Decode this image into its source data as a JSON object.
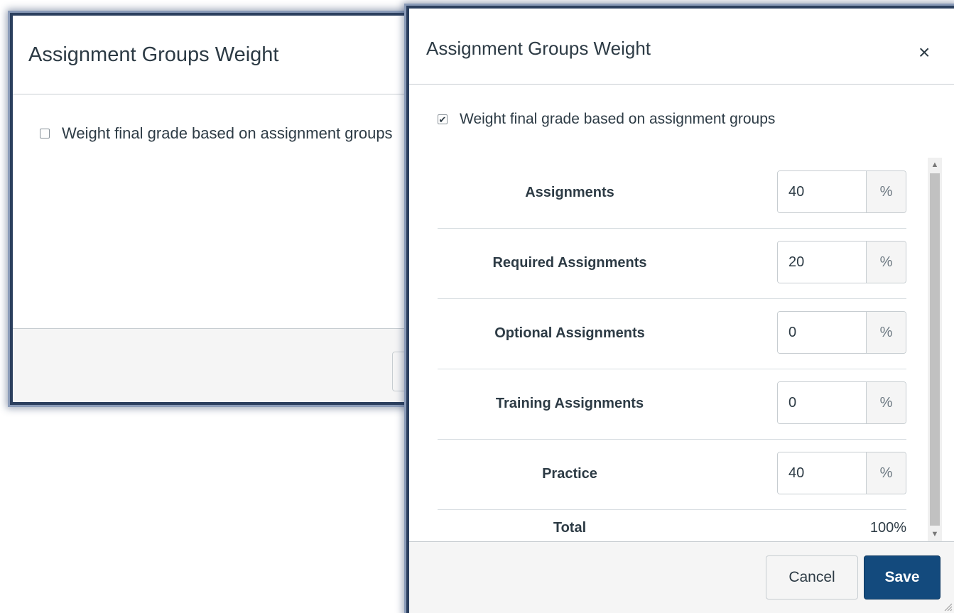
{
  "back_dialog": {
    "title": "Assignment Groups Weight",
    "checkbox_label": "Weight final grade based on assignment groups",
    "checked": false
  },
  "front_dialog": {
    "title": "Assignment Groups Weight",
    "close_glyph": "×",
    "checkbox_label": "Weight final grade based on assignment groups",
    "checked": true,
    "check_glyph": "✔",
    "groups": [
      {
        "name": "Assignments",
        "weight": "40",
        "unit": "%"
      },
      {
        "name": "Required Assignments",
        "weight": "20",
        "unit": "%"
      },
      {
        "name": "Optional Assignments",
        "weight": "0",
        "unit": "%"
      },
      {
        "name": "Training Assignments",
        "weight": "0",
        "unit": "%"
      },
      {
        "name": "Practice",
        "weight": "40",
        "unit": "%"
      }
    ],
    "total_label": "Total",
    "total_value": "100%",
    "scroll_up_glyph": "▲",
    "scroll_down_glyph": "▼",
    "buttons": {
      "cancel": "Cancel",
      "save": "Save"
    }
  },
  "colors": {
    "dialog_border": "#2b3f5e",
    "save_button": "#134a7d",
    "text": "#2d3b45",
    "footer_bg": "#f5f5f5"
  }
}
